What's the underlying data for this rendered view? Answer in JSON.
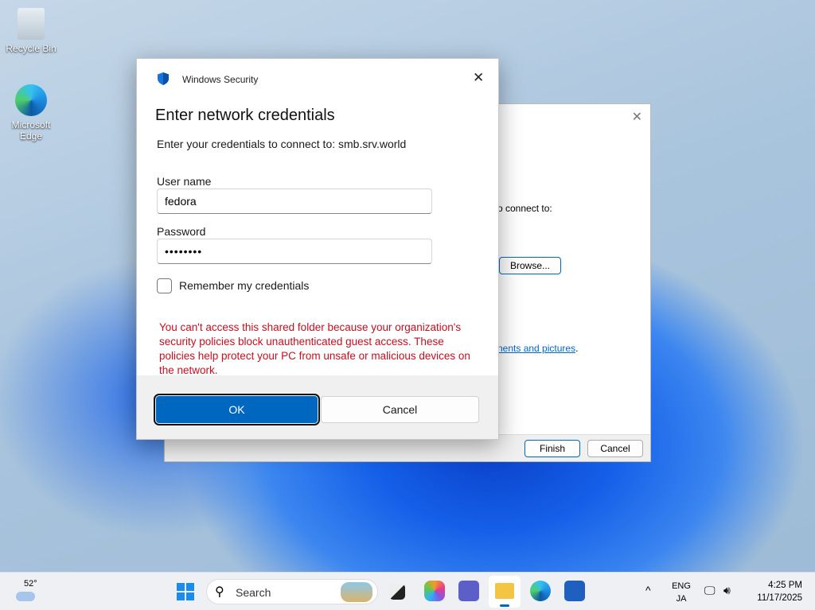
{
  "desktop": {
    "icons": [
      {
        "label": "Recycle Bin"
      },
      {
        "label": "Microsoft Edge"
      }
    ]
  },
  "wizard": {
    "partial_text": "o connect to:",
    "browse_label": "Browse...",
    "link_text": "nents and pictures",
    "link_suffix": ".",
    "finish_label": "Finish",
    "cancel_label": "Cancel"
  },
  "dialog": {
    "app_title": "Windows Security",
    "heading": "Enter network credentials",
    "subtitle": "Enter your credentials to connect to: smb.srv.world",
    "username_label": "User name",
    "username_value": "fedora",
    "password_label": "Password",
    "password_value": "••••••••",
    "remember_label": "Remember my credentials",
    "error": "You can't access this shared folder because your organization's security policies block unauthenticated guest access. These policies help protect your PC from unsafe or malicious devices on the network.",
    "ok_label": "OK",
    "cancel_label": "Cancel",
    "error_color": "#c50f1f",
    "accent": "#0067c0"
  },
  "taskbar": {
    "weather": "52°",
    "search_placeholder": "Search",
    "lang_top": "ENG",
    "lang_bottom": "JA",
    "time": "4:25 PM",
    "date": "11/17/2025"
  }
}
